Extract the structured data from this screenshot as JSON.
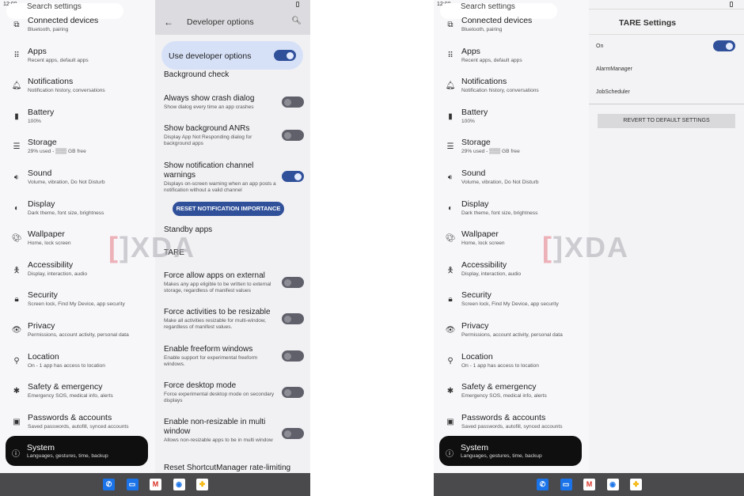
{
  "status": {
    "time": "12:00"
  },
  "sidebar": {
    "search_placeholder": "Search settings",
    "items": [
      {
        "icon": "devices-icon",
        "glyph": "⧉",
        "title": "Connected devices",
        "subtitle": "Bluetooth, pairing"
      },
      {
        "icon": "apps-grid-icon",
        "glyph": "⠿",
        "title": "Apps",
        "subtitle": "Recent apps, default apps"
      },
      {
        "icon": "bell-icon",
        "glyph": "🔔︎",
        "title": "Notifications",
        "subtitle": "Notification history, conversations"
      },
      {
        "icon": "battery-icon",
        "glyph": "▮",
        "title": "Battery",
        "subtitle": "100%"
      },
      {
        "icon": "storage-icon",
        "glyph": "☰",
        "title": "Storage",
        "subtitle": "29% used - ▒▒▒ GB free"
      },
      {
        "icon": "volume-icon",
        "glyph": "🔉︎",
        "title": "Sound",
        "subtitle": "Volume, vibration, Do Not Disturb"
      },
      {
        "icon": "display-icon",
        "glyph": "◐",
        "title": "Display",
        "subtitle": "Dark theme, font size, brightness"
      },
      {
        "icon": "palette-icon",
        "glyph": "🎨︎",
        "title": "Wallpaper",
        "subtitle": "Home, lock screen"
      },
      {
        "icon": "accessibility-icon",
        "glyph": "🯅",
        "title": "Accessibility",
        "subtitle": "Display, interaction, audio"
      },
      {
        "icon": "lock-icon",
        "glyph": "🔒︎",
        "title": "Security",
        "subtitle": "Screen lock, Find My Device, app security"
      },
      {
        "icon": "eye-icon",
        "glyph": "👁︎",
        "title": "Privacy",
        "subtitle": "Permissions, account activity, personal data"
      },
      {
        "icon": "location-pin-icon",
        "glyph": "⚲",
        "title": "Location",
        "subtitle": "On - 1 app has access to location"
      },
      {
        "icon": "asterisk-icon",
        "glyph": "✱",
        "title": "Safety & emergency",
        "subtitle": "Emergency SOS, medical info, alerts"
      },
      {
        "icon": "account-box-icon",
        "glyph": "▣",
        "title": "Passwords & accounts",
        "subtitle": "Saved passwords, autofill, synced accounts"
      },
      {
        "icon": "info-icon",
        "glyph": "ⓘ",
        "title": "System",
        "subtitle": "Languages, gestures, time, backup",
        "selected": true
      }
    ]
  },
  "developer_options": {
    "title": "Developer options",
    "use_label": "Use developer options",
    "use_enabled": true,
    "partial_top": "Background check",
    "items": [
      {
        "title": "Always show crash dialog",
        "subtitle": "Show dialog every time an app crashes",
        "on": false
      },
      {
        "title": "Show background ANRs",
        "subtitle": "Display App Not Responding dialog for background apps",
        "on": false
      },
      {
        "title": "Show notification channel warnings",
        "subtitle": "Displays on-screen warning when an app posts a notification without a valid channel",
        "on": true
      }
    ],
    "reset_button": "RESET NOTIFICATION IMPORTANCE",
    "standby": "Standby apps",
    "tare": "TARE",
    "items2": [
      {
        "title": "Force allow apps on external",
        "subtitle": "Makes any app eligible to be written to external storage, regardless of manifest values",
        "on": false
      },
      {
        "title": "Force activities to be resizable",
        "subtitle": "Make all activities resizable for multi-window, regardless of manifest values.",
        "on": false
      },
      {
        "title": "Enable freeform windows",
        "subtitle": "Enable support for experimental freeform windows.",
        "on": false
      },
      {
        "title": "Force desktop mode",
        "subtitle": "Force experimental desktop mode on secondary displays",
        "on": false
      },
      {
        "title": "Enable non-resizable in multi window",
        "subtitle": "Allows non-resizable apps to be in multi window",
        "on": false
      }
    ],
    "partial_bottom": "Reset ShortcutManager rate-limiting"
  },
  "tare_settings": {
    "title": "TARE Settings",
    "on_label": "On",
    "on_enabled": true,
    "alarm": "AlarmManager",
    "job": "JobScheduler",
    "revert": "REVERT TO DEFAULT SETTINGS"
  },
  "taskbar": [
    {
      "icon": "phone-icon",
      "glyph": "✆",
      "bg": "#1a73e8",
      "fg": "#fff"
    },
    {
      "icon": "messages-icon",
      "glyph": "▭",
      "bg": "#1a73e8",
      "fg": "#fff"
    },
    {
      "icon": "gmail-icon",
      "glyph": "M",
      "bg": "#ffffff",
      "fg": "#d93025"
    },
    {
      "icon": "chrome-icon",
      "glyph": "◉",
      "bg": "#ffffff",
      "fg": "#1a73e8"
    },
    {
      "icon": "photos-icon",
      "glyph": "✤",
      "bg": "#ffffff",
      "fg": "#f4b400"
    }
  ],
  "watermark": "XDA",
  "colors": {
    "accent": "#30509a",
    "card": "#d6e1f8",
    "taskbar": "#4a4a4d"
  }
}
